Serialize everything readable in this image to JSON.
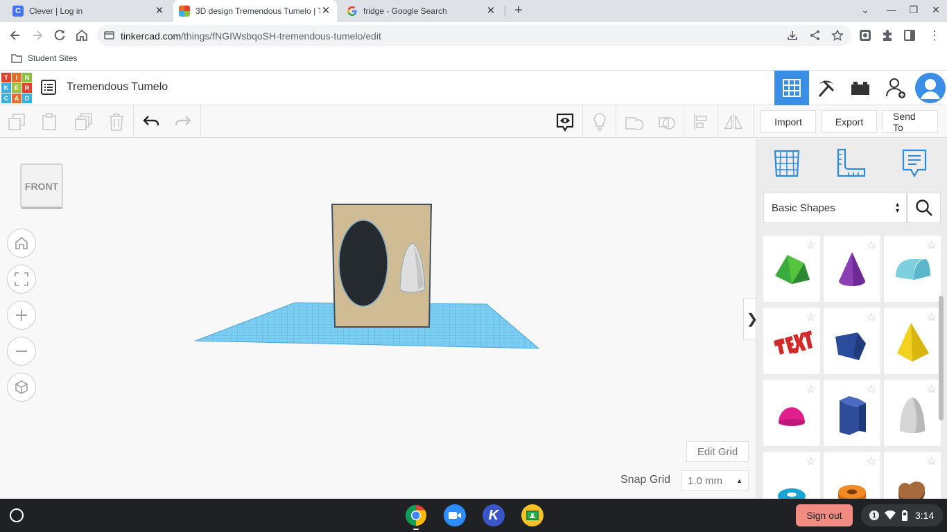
{
  "browser": {
    "tabs": [
      {
        "label": "Clever | Log in",
        "close": "✕"
      },
      {
        "label": "3D design Tremendous Tumelo | Tinkercad",
        "close": "✕"
      },
      {
        "label": "fridge - Google Search",
        "close": "✕"
      }
    ],
    "new_tab": "+",
    "url_host": "tinkercad.com",
    "url_path": "/things/fNGIWsbqoSH-tremendous-tumelo/edit",
    "bookmark": "Student Sites",
    "clever_letter": "C"
  },
  "app": {
    "design_title": "Tremendous Tumelo",
    "logo_letters": [
      "T",
      "I",
      "N",
      "K",
      "E",
      "R",
      "C",
      "A",
      "D"
    ],
    "logo_colors": [
      "#e2422c",
      "#e76d2b",
      "#8ac33f",
      "#3ab0e2",
      "#9ac33f",
      "#e2422c",
      "#3ab0e2",
      "#e76d2b",
      "#3ab0e2"
    ],
    "accent": "#3a8ee6"
  },
  "toolbar": {
    "import": "Import",
    "export": "Export",
    "send_to": "Send To"
  },
  "viewcube": {
    "face": "FRONT"
  },
  "workplane": {
    "edit_grid": "Edit Grid",
    "snap_label": "Snap Grid",
    "snap_value": "1.0 mm",
    "collapse": "❯"
  },
  "library": {
    "selected": "Basic Shapes",
    "shapes": [
      "roof",
      "cone",
      "round-roof",
      "text",
      "polygon",
      "pyramid",
      "half-sphere",
      "hexagonal-prism",
      "paraboloid",
      "torus",
      "tube",
      "heart"
    ]
  },
  "shelf": {
    "sign_out": "Sign out",
    "notifications": "1",
    "time": "3:14",
    "k_letter": "K"
  }
}
